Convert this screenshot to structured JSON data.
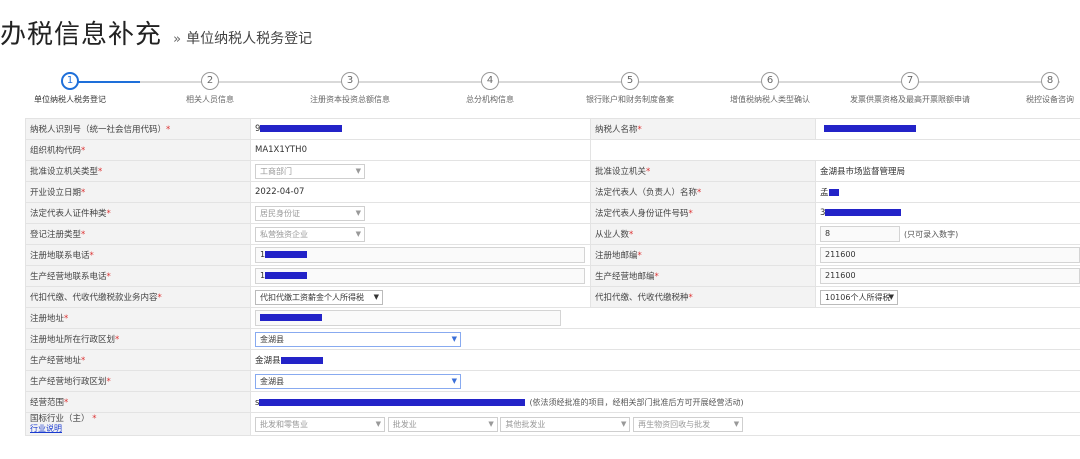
{
  "header": {
    "title": "办税信息补充",
    "separator": "»",
    "subtitle": "单位纳税人税务登记"
  },
  "steps": [
    {
      "num": "1",
      "label": "单位纳税人税务登记",
      "active": true
    },
    {
      "num": "2",
      "label": "相关人员信息",
      "active": false
    },
    {
      "num": "3",
      "label": "注册资本投资总额信息",
      "active": false
    },
    {
      "num": "4",
      "label": "总分机构信息",
      "active": false
    },
    {
      "num": "5",
      "label": "银行账户和财务制度备案",
      "active": false
    },
    {
      "num": "6",
      "label": "增值税纳税人类型确认",
      "active": false
    },
    {
      "num": "7",
      "label": "发票供票资格及最高开票限额申请",
      "active": false
    },
    {
      "num": "8",
      "label": "税控设备咨询",
      "active": false
    }
  ],
  "form": {
    "taxpayer_id_label": "纳税人识别号（统一社会信用代码）",
    "taxpayer_id_prefix": "9",
    "taxpayer_name_label": "纳税人名称",
    "org_code_label": "组织机构代码",
    "org_code_value": "MA1X1YTH0",
    "approval_org_type_label": "批准设立机关类型",
    "approval_org_type_value": "工商部门",
    "approval_org_label": "批准设立机关",
    "approval_org_value": "金湖县市场监督管理局",
    "establish_date_label": "开业设立日期",
    "establish_date_value": "2022-04-07",
    "legal_rep_name_label": "法定代表人（负责人）名称",
    "legal_rep_name_prefix": "孟",
    "legal_rep_id_type_label": "法定代表人证件种类",
    "legal_rep_id_type_value": "居民身份证",
    "legal_rep_id_no_label": "法定代表人身份证件号码",
    "legal_rep_id_no_prefix": "3",
    "reg_type_label": "登记注册类型",
    "reg_type_value": "私营独资企业",
    "employees_label": "从业人数",
    "employees_value": "8",
    "employees_hint": "(只可录入数字)",
    "reg_phone_label": "注册地联系电话",
    "reg_phone_prefix": "1",
    "reg_postcode_label": "注册地邮编",
    "reg_postcode_value": "211600",
    "biz_phone_label": "生产经营地联系电话",
    "biz_phone_prefix": "1",
    "biz_postcode_label": "生产经营地邮编",
    "biz_postcode_value": "211600",
    "withholding_label": "代扣代缴、代收代缴税款业务内容",
    "withholding_value": "代扣代缴工资薪金个人所得税",
    "withholding_tax_label": "代扣代缴、代收代缴税种",
    "withholding_tax_value": "10106个人所得税",
    "reg_address_label": "注册地址",
    "reg_district_label": "注册地址所在行政区划",
    "reg_district_value": "金湖县",
    "biz_address_label": "生产经营地址",
    "biz_address_prefix": "金湖县",
    "biz_district_label": "生产经营地行政区划",
    "biz_district_value": "金湖县",
    "scope_label": "经营范围",
    "scope_prefix": "s",
    "scope_hint": "(依法须经批准的项目，经相关部门批准后方可开展经营活动)",
    "industry_label": "国标行业（主）",
    "industry_link": "行业说明",
    "industry_sel1": "批发和零售业",
    "industry_sel2": "批发业",
    "industry_sel3": "其他批发业",
    "industry_sel4": "再生物资回收与批发"
  },
  "colors": {
    "accent": "#1e6fd9",
    "required": "#dd3333",
    "redaction": "#2323c8"
  }
}
